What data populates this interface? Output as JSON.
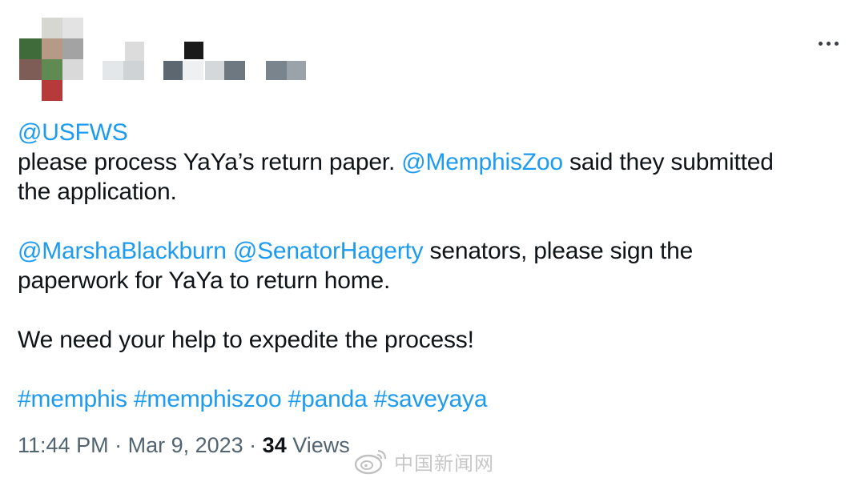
{
  "tweet": {
    "author_avatar": "pixelated-avatar",
    "author_name": "pixelated-name",
    "more_icon": "more-horizontal-icon",
    "line1": {
      "mention": "@USFWS"
    },
    "line2": {
      "text_a": "please process YaYa’s return paper. ",
      "mention": "@MemphisZoo",
      "text_b": " said they submitted"
    },
    "line3": {
      "text": "the application."
    },
    "line4": {
      "mention1": "@MarshaBlackburn",
      "sep": " ",
      "mention2": "@SenatorHagerty",
      "text": " senators, please sign the"
    },
    "line5": {
      "text": "paperwork for YaYa to return home."
    },
    "line6": {
      "text": "We need your help to expedite the process!"
    },
    "hashtags": [
      "#memphis",
      "#memphiszoo",
      "#panda",
      "#saveyaya"
    ],
    "meta": {
      "time": "11:44 PM",
      "separator": " · ",
      "date": "Mar 9, 2023",
      "views_count": "34",
      "views_label": " Views"
    }
  },
  "watermark": {
    "icon": "weibo-logo-icon",
    "text": "中国新闻网"
  },
  "colors": {
    "link": "#1d9bf0",
    "text": "#0f1419",
    "secondary": "#536471"
  }
}
